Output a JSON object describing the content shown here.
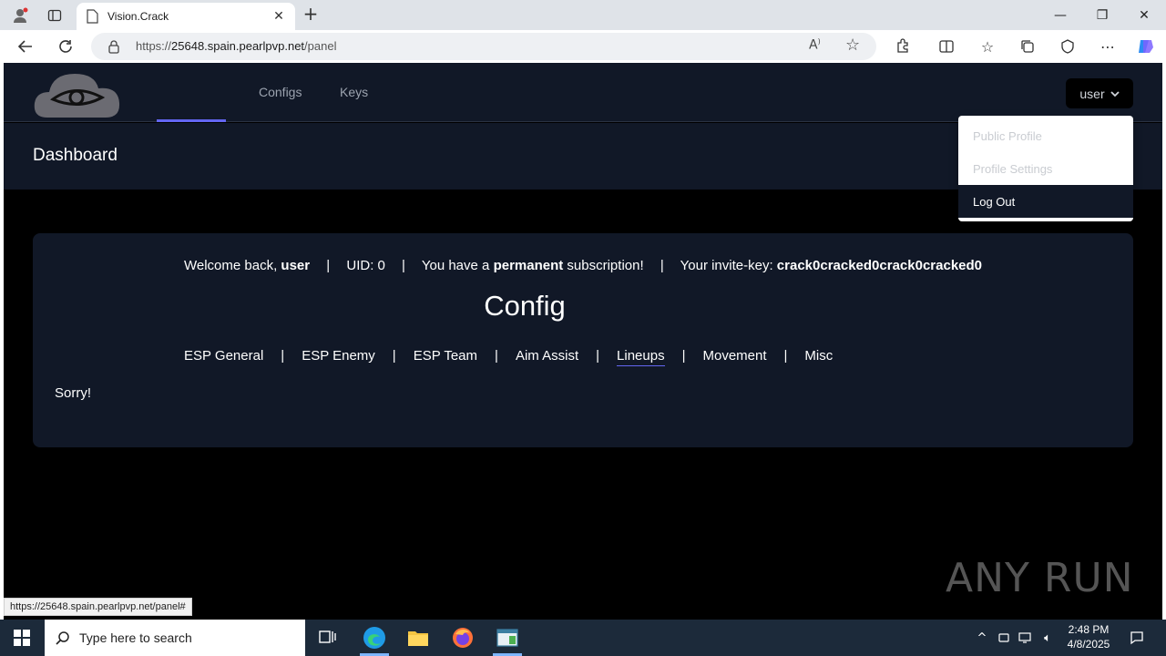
{
  "browser": {
    "tab_title": "Vision.Crack",
    "url_prefix": "https://",
    "url_host": "25648.spain.pearlpvp.net",
    "url_path": "/panel",
    "status_url": "https://25648.spain.pearlpvp.net/panel#"
  },
  "site": {
    "nav": [
      "Configs",
      "Keys"
    ],
    "user_button": "user",
    "dashboard_title": "Dashboard",
    "dropdown": {
      "public_profile": "Public Profile",
      "profile_settings": "Profile Settings",
      "log_out": "Log Out"
    },
    "welcome": {
      "prefix": "Welcome back,",
      "username": "user",
      "uid": "UID: 0",
      "sub_prefix": "You have a",
      "sub_type": "permanent",
      "sub_suffix": "subscription!",
      "invite_prefix": "Your invite-key:",
      "invite_key": "crack0cracked0crack0cracked0",
      "separator": "|"
    },
    "config_title": "Config",
    "config_tabs": [
      "ESP General",
      "ESP Enemy",
      "ESP Team",
      "Aim Assist",
      "Lineups",
      "Movement",
      "Misc"
    ],
    "selected_tab": "Lineups",
    "message": "Sorry!"
  },
  "watermark": "ANY RUN",
  "taskbar": {
    "search_placeholder": "Type here to search",
    "time": "2:48 PM",
    "date": "4/8/2025"
  },
  "colors": {
    "navbar_bg": "#111827",
    "accent": "#6366f1",
    "page_bg": "#000000"
  }
}
